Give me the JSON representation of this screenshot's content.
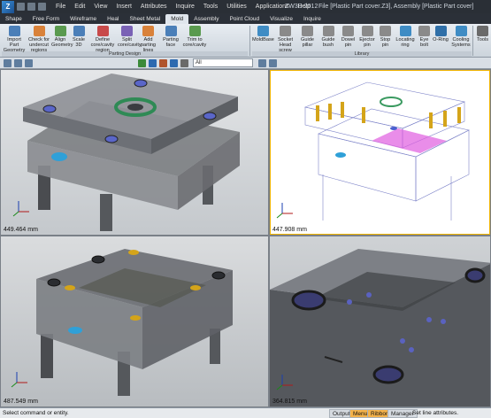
{
  "app": {
    "logo": "Z",
    "version": "ZW3D 2012",
    "title": "File [Plastic Part cover.Z3], Assembly [Plastic Part cover]"
  },
  "menus": [
    "File",
    "Edit",
    "View",
    "Insert",
    "Attributes",
    "Inquire",
    "Tools",
    "Utilities",
    "Applications",
    "Help"
  ],
  "tabs": [
    {
      "label": "Shape",
      "active": false
    },
    {
      "label": "Free Form",
      "active": false
    },
    {
      "label": "Wireframe",
      "active": false
    },
    {
      "label": "Heal",
      "active": false
    },
    {
      "label": "Sheet Metal",
      "active": false
    },
    {
      "label": "Mold",
      "active": true
    },
    {
      "label": "Assembly",
      "active": false
    },
    {
      "label": "Point Cloud",
      "active": false
    },
    {
      "label": "Visualize",
      "active": false
    },
    {
      "label": "Inquire",
      "active": false
    }
  ],
  "ribbon": {
    "groups": [
      {
        "label": "Parting Design"
      },
      {
        "label": "Library"
      }
    ],
    "buttons": [
      {
        "label": "Import Part Geometry",
        "icon": "import-part-icon",
        "color": "#4b7fb8"
      },
      {
        "label": "Check for undercut regions",
        "icon": "undercut-check-icon",
        "color": "#d9823a"
      },
      {
        "label": "Align Geometry",
        "icon": "align-geometry-icon",
        "color": "#5a9a4f"
      },
      {
        "label": "Scale 3D",
        "icon": "scale-icon",
        "color": "#4b7fb8"
      },
      {
        "label": "Define core/cavity region",
        "icon": "define-region-icon",
        "color": "#c84a4a"
      },
      {
        "label": "Split core/cavity",
        "icon": "split-icon",
        "color": "#7a62b5"
      },
      {
        "label": "Add parting lines",
        "icon": "parting-lines-icon",
        "color": "#d9823a"
      },
      {
        "label": "Parting face",
        "icon": "parting-face-icon",
        "color": "#4b7fb8"
      },
      {
        "label": "Trim to core/cavity",
        "icon": "trim-icon",
        "color": "#5a9a4f"
      },
      {
        "label": "MoldBase",
        "icon": "moldbase-icon",
        "color": "#3f8cc4"
      },
      {
        "label": "Socket Head screw",
        "icon": "screw-icon",
        "color": "#8a8a8a"
      },
      {
        "label": "Guide pillar",
        "icon": "guide-pillar-icon",
        "color": "#8a8a8a"
      },
      {
        "label": "Guide bush",
        "icon": "guide-bush-icon",
        "color": "#8a8a8a"
      },
      {
        "label": "Dowel pin",
        "icon": "dowel-pin-icon",
        "color": "#8a8a8a"
      },
      {
        "label": "Ejector pin",
        "icon": "ejector-pin-icon",
        "color": "#8a8a8a"
      },
      {
        "label": "Stop pin",
        "icon": "stop-pin-icon",
        "color": "#8a8a8a"
      },
      {
        "label": "Locating ring",
        "icon": "locating-ring-icon",
        "color": "#3f8cc4"
      },
      {
        "label": "Eye bolt",
        "icon": "eye-bolt-icon",
        "color": "#8a8a8a"
      },
      {
        "label": "O-Ring",
        "icon": "o-ring-icon",
        "color": "#2f6fa8"
      },
      {
        "label": "Cooling Systems",
        "icon": "cooling-icon",
        "color": "#3f8cc4"
      },
      {
        "label": "Tools",
        "icon": "tools-icon",
        "color": "#6a6a6a"
      }
    ]
  },
  "toolbar": {
    "filter_value": "All"
  },
  "viewports": [
    {
      "name": "top-left",
      "measure": "449.464 mm",
      "style": "shaded"
    },
    {
      "name": "top-right",
      "measure": "447.908 mm",
      "style": "wireframe"
    },
    {
      "name": "bottom-left",
      "measure": "487.549 mm",
      "style": "shaded"
    },
    {
      "name": "bottom-right",
      "measure": "364.815 mm",
      "style": "shaded"
    }
  ],
  "statusbar": {
    "prompt": "Select command or entity.",
    "tabs": [
      {
        "label": "Output",
        "active": false
      },
      {
        "label": "Menu",
        "active": true
      },
      {
        "label": "Ribbon",
        "active": true
      },
      {
        "label": "Manager",
        "active": false
      }
    ],
    "message": "Set line attributes."
  },
  "colors": {
    "accent": "#f0b400",
    "titlebar": "#2a2f36",
    "pin_blue": "#4a5fd0",
    "mold_gray": "#6c7076"
  }
}
